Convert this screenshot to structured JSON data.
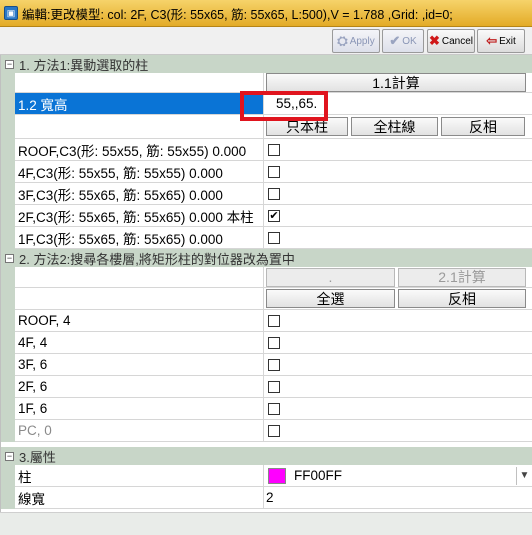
{
  "window": {
    "title": "編輯:更改模型: col: 2F, C3(形: 55x65, 筋: 55x65, L:500),V = 1.788 ,Grid: ,id=0;"
  },
  "toolbar": {
    "apply_label": "Apply",
    "ok_label": "OK",
    "cancel_label": "Cancel",
    "exit_label": "Exit"
  },
  "section1": {
    "title": "1. 方法1:異動選取的柱",
    "calc_button": "1.1計算",
    "size_label": "1.2 寬高",
    "size_value": "55,,65.",
    "only_button": "只本柱",
    "all_button": "全柱線",
    "invert_button": "反相",
    "items": [
      {
        "label": "ROOF,C3(形: 55x55, 筋: 55x55) 0.000",
        "checked": false
      },
      {
        "label": "4F,C3(形: 55x55, 筋: 55x55) 0.000",
        "checked": false
      },
      {
        "label": "3F,C3(形: 55x65, 筋: 55x65) 0.000",
        "checked": false
      },
      {
        "label": "2F,C3(形: 55x65, 筋: 55x65) 0.000 本柱",
        "checked": true
      },
      {
        "label": "1F,C3(形: 55x65, 筋: 55x65) 0.000",
        "checked": false
      }
    ]
  },
  "section2": {
    "title": "2. 方法2:搜尋各樓層,將矩形柱的對位器改為置中",
    "dot_button": ".",
    "calc_button": "2.1計算",
    "select_all_button": "全選",
    "invert_button": "反相",
    "items": [
      {
        "label": "ROOF, 4",
        "checked": false
      },
      {
        "label": "4F, 4",
        "checked": false
      },
      {
        "label": "3F, 6",
        "checked": false
      },
      {
        "label": "2F, 6",
        "checked": false
      },
      {
        "label": "1F, 6",
        "checked": false
      },
      {
        "label": "PC, 0",
        "checked": false
      }
    ]
  },
  "section3": {
    "title": "3.屬性",
    "column_label": "柱",
    "color_value": "FF00FF",
    "color_hex": "#ff00ff",
    "line_width_label": "線寬",
    "line_width_value": "2"
  }
}
